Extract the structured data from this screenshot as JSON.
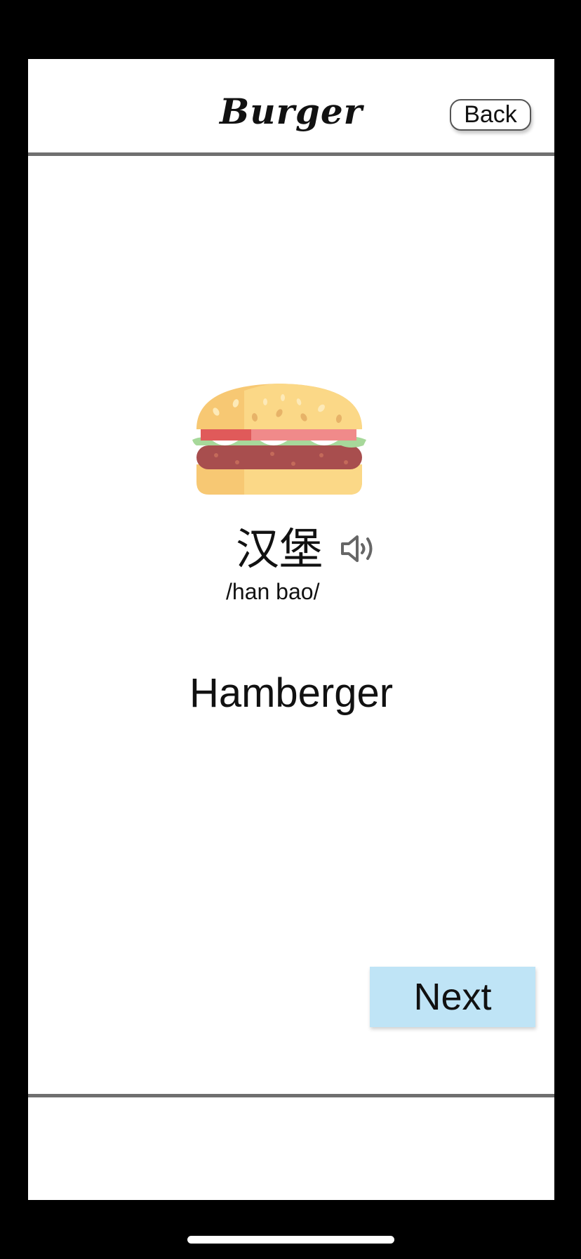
{
  "header": {
    "title": "Burger",
    "back_label": "Back"
  },
  "word": {
    "image_icon": "burger-icon",
    "chinese": "汉堡",
    "pinyin": "/han bao/",
    "english": "Hamberger",
    "audio_icon": "speaker-icon"
  },
  "footer": {
    "next_label": "Next"
  },
  "colors": {
    "next_button_bg": "#bfe4f6",
    "divider": "#6f6f6f",
    "bun": "#f7c873",
    "bun_light": "#fbd887",
    "tomato": "#e05a5a",
    "lettuce": "#a7d89a",
    "patty": "#a84e4e"
  }
}
